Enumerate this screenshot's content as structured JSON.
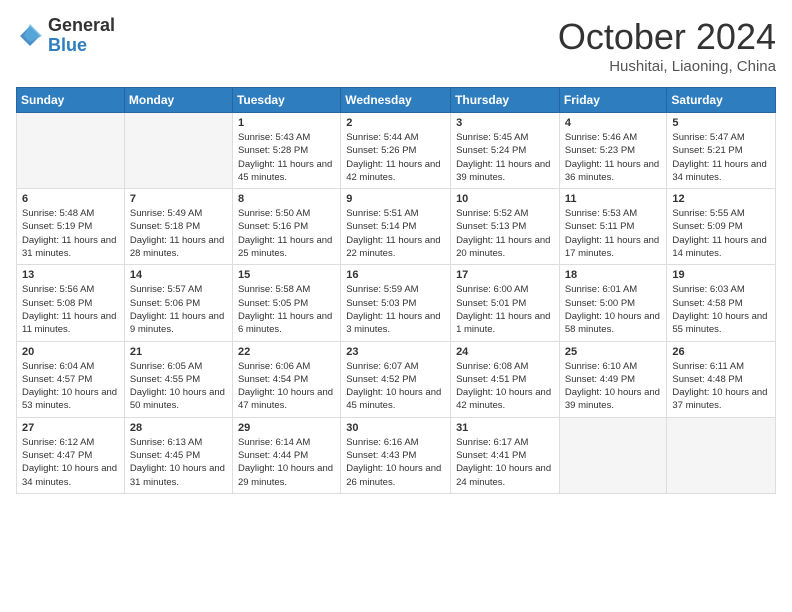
{
  "header": {
    "logo": {
      "general": "General",
      "blue": "Blue"
    },
    "title": "October 2024",
    "subtitle": "Hushitai, Liaoning, China"
  },
  "days_of_week": [
    "Sunday",
    "Monday",
    "Tuesday",
    "Wednesday",
    "Thursday",
    "Friday",
    "Saturday"
  ],
  "weeks": [
    [
      {
        "day": "",
        "info": ""
      },
      {
        "day": "",
        "info": ""
      },
      {
        "day": "1",
        "info": "Sunrise: 5:43 AM\nSunset: 5:28 PM\nDaylight: 11 hours and 45 minutes."
      },
      {
        "day": "2",
        "info": "Sunrise: 5:44 AM\nSunset: 5:26 PM\nDaylight: 11 hours and 42 minutes."
      },
      {
        "day": "3",
        "info": "Sunrise: 5:45 AM\nSunset: 5:24 PM\nDaylight: 11 hours and 39 minutes."
      },
      {
        "day": "4",
        "info": "Sunrise: 5:46 AM\nSunset: 5:23 PM\nDaylight: 11 hours and 36 minutes."
      },
      {
        "day": "5",
        "info": "Sunrise: 5:47 AM\nSunset: 5:21 PM\nDaylight: 11 hours and 34 minutes."
      }
    ],
    [
      {
        "day": "6",
        "info": "Sunrise: 5:48 AM\nSunset: 5:19 PM\nDaylight: 11 hours and 31 minutes."
      },
      {
        "day": "7",
        "info": "Sunrise: 5:49 AM\nSunset: 5:18 PM\nDaylight: 11 hours and 28 minutes."
      },
      {
        "day": "8",
        "info": "Sunrise: 5:50 AM\nSunset: 5:16 PM\nDaylight: 11 hours and 25 minutes."
      },
      {
        "day": "9",
        "info": "Sunrise: 5:51 AM\nSunset: 5:14 PM\nDaylight: 11 hours and 22 minutes."
      },
      {
        "day": "10",
        "info": "Sunrise: 5:52 AM\nSunset: 5:13 PM\nDaylight: 11 hours and 20 minutes."
      },
      {
        "day": "11",
        "info": "Sunrise: 5:53 AM\nSunset: 5:11 PM\nDaylight: 11 hours and 17 minutes."
      },
      {
        "day": "12",
        "info": "Sunrise: 5:55 AM\nSunset: 5:09 PM\nDaylight: 11 hours and 14 minutes."
      }
    ],
    [
      {
        "day": "13",
        "info": "Sunrise: 5:56 AM\nSunset: 5:08 PM\nDaylight: 11 hours and 11 minutes."
      },
      {
        "day": "14",
        "info": "Sunrise: 5:57 AM\nSunset: 5:06 PM\nDaylight: 11 hours and 9 minutes."
      },
      {
        "day": "15",
        "info": "Sunrise: 5:58 AM\nSunset: 5:05 PM\nDaylight: 11 hours and 6 minutes."
      },
      {
        "day": "16",
        "info": "Sunrise: 5:59 AM\nSunset: 5:03 PM\nDaylight: 11 hours and 3 minutes."
      },
      {
        "day": "17",
        "info": "Sunrise: 6:00 AM\nSunset: 5:01 PM\nDaylight: 11 hours and 1 minute."
      },
      {
        "day": "18",
        "info": "Sunrise: 6:01 AM\nSunset: 5:00 PM\nDaylight: 10 hours and 58 minutes."
      },
      {
        "day": "19",
        "info": "Sunrise: 6:03 AM\nSunset: 4:58 PM\nDaylight: 10 hours and 55 minutes."
      }
    ],
    [
      {
        "day": "20",
        "info": "Sunrise: 6:04 AM\nSunset: 4:57 PM\nDaylight: 10 hours and 53 minutes."
      },
      {
        "day": "21",
        "info": "Sunrise: 6:05 AM\nSunset: 4:55 PM\nDaylight: 10 hours and 50 minutes."
      },
      {
        "day": "22",
        "info": "Sunrise: 6:06 AM\nSunset: 4:54 PM\nDaylight: 10 hours and 47 minutes."
      },
      {
        "day": "23",
        "info": "Sunrise: 6:07 AM\nSunset: 4:52 PM\nDaylight: 10 hours and 45 minutes."
      },
      {
        "day": "24",
        "info": "Sunrise: 6:08 AM\nSunset: 4:51 PM\nDaylight: 10 hours and 42 minutes."
      },
      {
        "day": "25",
        "info": "Sunrise: 6:10 AM\nSunset: 4:49 PM\nDaylight: 10 hours and 39 minutes."
      },
      {
        "day": "26",
        "info": "Sunrise: 6:11 AM\nSunset: 4:48 PM\nDaylight: 10 hours and 37 minutes."
      }
    ],
    [
      {
        "day": "27",
        "info": "Sunrise: 6:12 AM\nSunset: 4:47 PM\nDaylight: 10 hours and 34 minutes."
      },
      {
        "day": "28",
        "info": "Sunrise: 6:13 AM\nSunset: 4:45 PM\nDaylight: 10 hours and 31 minutes."
      },
      {
        "day": "29",
        "info": "Sunrise: 6:14 AM\nSunset: 4:44 PM\nDaylight: 10 hours and 29 minutes."
      },
      {
        "day": "30",
        "info": "Sunrise: 6:16 AM\nSunset: 4:43 PM\nDaylight: 10 hours and 26 minutes."
      },
      {
        "day": "31",
        "info": "Sunrise: 6:17 AM\nSunset: 4:41 PM\nDaylight: 10 hours and 24 minutes."
      },
      {
        "day": "",
        "info": ""
      },
      {
        "day": "",
        "info": ""
      }
    ]
  ]
}
